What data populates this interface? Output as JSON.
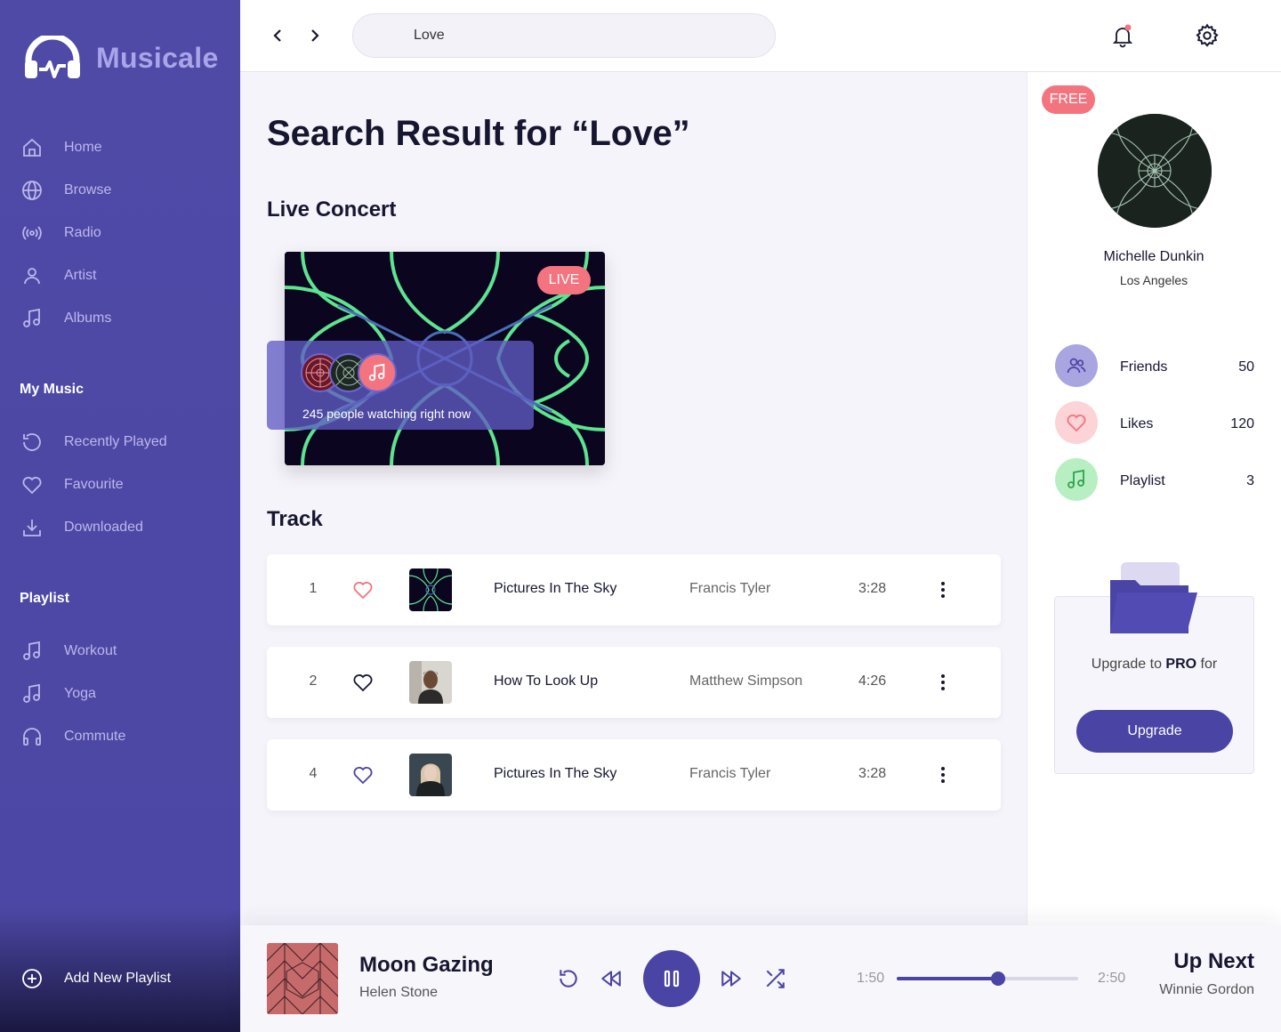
{
  "app": {
    "name": "Musicale"
  },
  "sidebar": {
    "nav": [
      {
        "label": "Home",
        "icon": "home-icon"
      },
      {
        "label": "Browse",
        "icon": "globe-icon"
      },
      {
        "label": "Radio",
        "icon": "radio-icon"
      },
      {
        "label": "Artist",
        "icon": "user-icon"
      },
      {
        "label": "Albums",
        "icon": "music-note-icon"
      }
    ],
    "my_music_title": "My Music",
    "my_music": [
      {
        "label": "Recently Played",
        "icon": "history-icon"
      },
      {
        "label": "Favourite",
        "icon": "heart-icon"
      },
      {
        "label": "Downloaded",
        "icon": "download-icon"
      }
    ],
    "playlist_title": "Playlist",
    "playlists": [
      {
        "label": "Workout",
        "icon": "music-note-icon"
      },
      {
        "label": "Yoga",
        "icon": "music-note-icon"
      },
      {
        "label": "Commute",
        "icon": "headphones-icon"
      }
    ],
    "add_playlist_label": "Add New Playlist"
  },
  "topbar": {
    "search_value": "Love"
  },
  "main": {
    "title": "Search Result for “Love”",
    "live_section_title": "Live Concert",
    "live_badge": "LIVE",
    "watching_text": "245 people watching right now",
    "track_section_title": "Track",
    "tracks": [
      {
        "num": "1",
        "title": "Pictures In The Sky",
        "artist": "Francis Tyler",
        "duration": "3:28",
        "liked": true
      },
      {
        "num": "2",
        "title": "How To Look Up",
        "artist": "Matthew Simpson",
        "duration": "4:26",
        "liked": false
      },
      {
        "num": "4",
        "title": "Pictures In The Sky",
        "artist": "Francis Tyler",
        "duration": "3:28",
        "liked": false
      }
    ]
  },
  "profile": {
    "badge": "FREE",
    "name": "Michelle Dunkin",
    "city": "Los Angeles",
    "stats": [
      {
        "label": "Friends",
        "value": "50",
        "icon": "friends-icon",
        "color": "#a9a5e0"
      },
      {
        "label": "Likes",
        "value": "120",
        "icon": "heart-icon",
        "color": "#fcd3d6"
      },
      {
        "label": "Playlist",
        "value": "3",
        "icon": "music-note-icon",
        "color": "#b8efc2"
      }
    ],
    "upgrade_text_pre": "Upgrade to ",
    "upgrade_text_bold": "PRO",
    "upgrade_text_post": " for",
    "upgrade_button": "Upgrade"
  },
  "player": {
    "title": "Moon Gazing",
    "artist": "Helen Stone",
    "elapsed": "1:50",
    "total": "2:50",
    "progress": 0.56,
    "up_next_label": "Up Next",
    "up_next_artist": "Winnie Gordon"
  },
  "colors": {
    "brand": "#4f4aa6",
    "accent": "#f3747f",
    "live_green": "#5ee38f"
  }
}
